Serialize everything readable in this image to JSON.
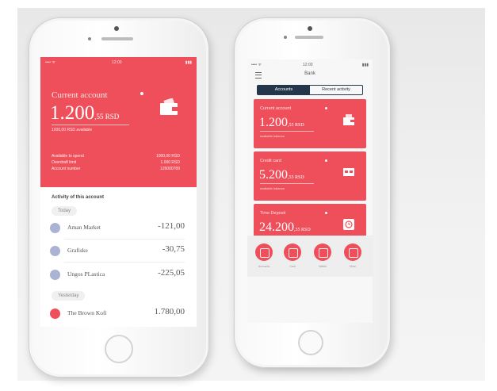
{
  "left_phone": {
    "status_bar": {
      "left": "•••• ᯤ",
      "center": "12:00",
      "right": "▮▮▮"
    },
    "account": {
      "title": "Current account",
      "balance_main": "1.200",
      "balance_fraction": ",55 RSD",
      "subtitle": "1000,00 RSD available",
      "details": [
        {
          "label": "Available to spend",
          "value": "1000,00 RSD"
        },
        {
          "label": "Overdraft limit",
          "value": "1.000 RSD"
        },
        {
          "label": "Account number",
          "value": "125000789"
        }
      ]
    },
    "activity": {
      "title": "Activity of this account",
      "groups": [
        {
          "chip": "Today",
          "items": [
            {
              "name": "Aman Market",
              "amount": "-121,00"
            },
            {
              "name": "Grafiske",
              "amount": "-30,75"
            },
            {
              "name": "Ungos PLastica",
              "amount": "-225,05"
            }
          ]
        },
        {
          "chip": "Yesterday",
          "items": [
            {
              "name": "The Brown Kofi",
              "amount": "1.780,00"
            }
          ]
        }
      ]
    },
    "colors": {
      "accent": "#ef4f5a",
      "tx_icon": "#aab3d4"
    }
  },
  "right_phone": {
    "status_bar": {
      "left": "•••• ᯤ",
      "center": "12:00",
      "right": "▮▮▮"
    },
    "title": "Bank",
    "segments": [
      "Accounts",
      "Recent activity"
    ],
    "cards": [
      {
        "title": "Current account",
        "value_main": "1.200",
        "value_fraction": ",55 RSD",
        "sub": "available balance",
        "icon": "wallet-icon"
      },
      {
        "title": "Credit card",
        "value_main": "5.200",
        "value_fraction": ",55 RSD",
        "sub": "available balance",
        "icon": "card-icon"
      },
      {
        "title": "Time Deposit",
        "value_main": "24.200",
        "value_fraction": ",55 RSD",
        "sub": "available balance",
        "icon": "clock-icon"
      }
    ],
    "tabs": [
      "Accounts",
      "Card",
      "Wallet",
      "More"
    ],
    "colors": {
      "accent": "#ef4f5a",
      "segment": "#24374a"
    }
  }
}
